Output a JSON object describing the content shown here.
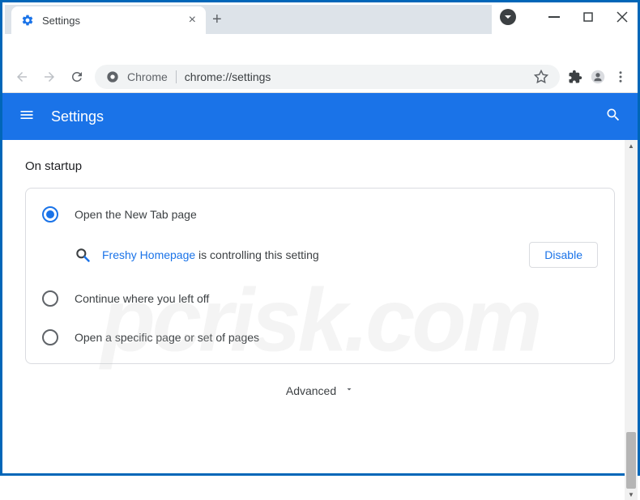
{
  "window": {
    "tab_title": "Settings",
    "url_prefix": "Chrome",
    "url_path": "chrome://settings"
  },
  "header": {
    "title": "Settings"
  },
  "content": {
    "section_title": "On startup",
    "options": {
      "new_tab": "Open the New Tab page",
      "continue": "Continue where you left off",
      "specific": "Open a specific page or set of pages"
    },
    "extension": {
      "name": "Freshy Homepage",
      "suffix": " is controlling this setting",
      "disable_label": "Disable"
    },
    "advanced_label": "Advanced"
  },
  "watermark": "pcrisk.com"
}
